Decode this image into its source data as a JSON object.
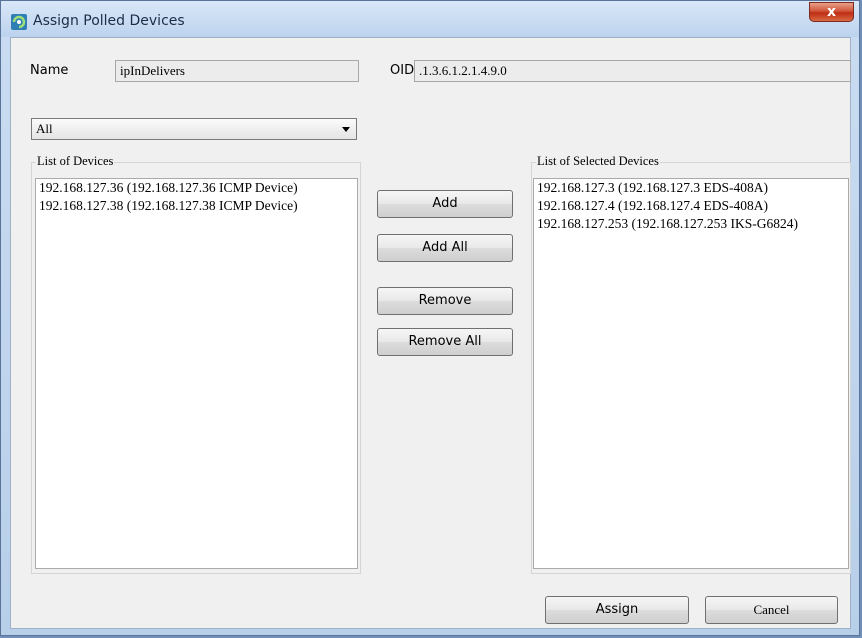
{
  "window": {
    "title": "Assign Polled Devices",
    "close_label": "x"
  },
  "form": {
    "name_label": "Name",
    "name_value": "ipInDelivers",
    "oid_label": "OID",
    "oid_value": ".1.3.6.1.2.1.4.9.0",
    "filter_value": "All"
  },
  "devices": {
    "title": "List of Devices",
    "items": [
      "192.168.127.36 (192.168.127.36 ICMP Device)",
      "192.168.127.38 (192.168.127.38 ICMP Device)"
    ]
  },
  "selected": {
    "title": "List of Selected Devices",
    "items": [
      "192.168.127.3 (192.168.127.3 EDS-408A)",
      "192.168.127.4 (192.168.127.4 EDS-408A)",
      "192.168.127.253 (192.168.127.253 IKS-G6824)"
    ]
  },
  "buttons": {
    "add": "Add",
    "add_all": "Add All",
    "remove": "Remove",
    "remove_all": "Remove All",
    "assign": "Assign",
    "cancel": "Cancel"
  }
}
